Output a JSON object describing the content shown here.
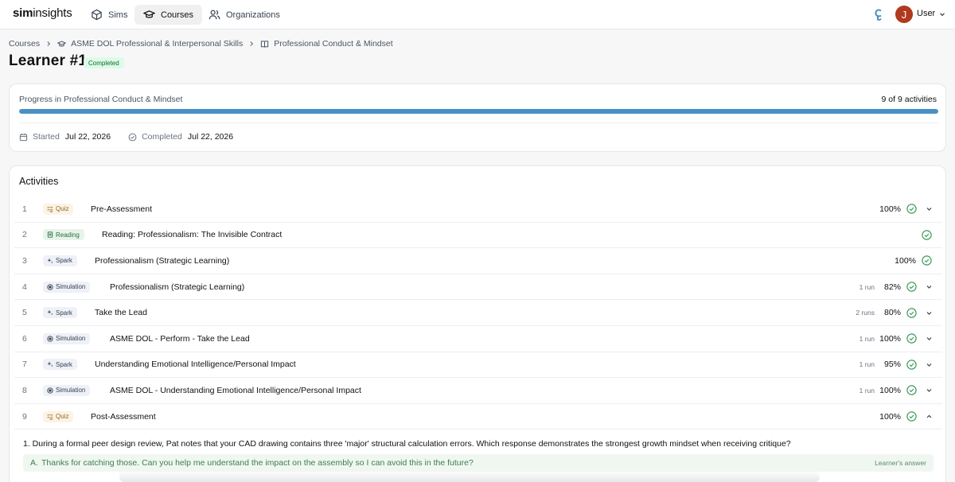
{
  "nav": {
    "logo_bold": "sim",
    "logo_light": "insights",
    "tabs": [
      {
        "label": "Sims",
        "icon": "cube-icon",
        "active": false
      },
      {
        "label": "Courses",
        "icon": "graduation-cap-icon",
        "active": true
      },
      {
        "label": "Organizations",
        "icon": "people-icon",
        "active": false
      }
    ],
    "user_initial": "J",
    "user_label": "User",
    "avatar_color": "#b0391e"
  },
  "breadcrumb": {
    "root": "Courses",
    "course": "ASME DOL Professional & Interpersonal Skills",
    "module": "Professional Conduct & Mindset"
  },
  "header": {
    "title": "Learner #1",
    "status_badge": "Completed"
  },
  "progress": {
    "label": "Progress in Professional Conduct & Mindset",
    "count_text": "9 of 9 activities",
    "fraction": 1.0,
    "started_label": "Started",
    "started_date": "Jul 22, 2026",
    "completed_label": "Completed",
    "completed_date": "Jul 22, 2026",
    "bar_color": "#4a90c4"
  },
  "activities": {
    "heading": "Activities",
    "rows": [
      {
        "num": "1",
        "type": "Quiz",
        "kind": "quiz",
        "title": "Pre-Assessment",
        "runs": "",
        "score": "100%",
        "expand": "down"
      },
      {
        "num": "2",
        "type": "Reading",
        "kind": "reading",
        "title": "Reading: Professionalism: The Invisible Contract",
        "runs": "",
        "score": "",
        "expand": "none"
      },
      {
        "num": "3",
        "type": "Spark",
        "kind": "spark",
        "title": "Professionalism (Strategic Learning)",
        "runs": "",
        "score": "100%",
        "expand": "none"
      },
      {
        "num": "4",
        "type": "Simulation",
        "kind": "sim",
        "title": "Professionalism (Strategic Learning)",
        "runs": "1 run",
        "score": "82%",
        "expand": "down"
      },
      {
        "num": "5",
        "type": "Spark",
        "kind": "spark",
        "title": "Take the Lead",
        "runs": "2 runs",
        "score": "80%",
        "expand": "down"
      },
      {
        "num": "6",
        "type": "Simulation",
        "kind": "sim",
        "title": "ASME DOL - Perform - Take the Lead",
        "runs": "1 run",
        "score": "100%",
        "expand": "down"
      },
      {
        "num": "7",
        "type": "Spark",
        "kind": "spark",
        "title": "Understanding Emotional Intelligence/Personal Impact",
        "runs": "1 run",
        "score": "95%",
        "expand": "down"
      },
      {
        "num": "8",
        "type": "Simulation",
        "kind": "sim",
        "title": "ASME DOL - Understanding Emotional Intelligence/Personal Impact",
        "runs": "1 run",
        "score": "100%",
        "expand": "down"
      },
      {
        "num": "9",
        "type": "Quiz",
        "kind": "quiz",
        "title": "Post-Assessment",
        "runs": "",
        "score": "100%",
        "expand": "up"
      }
    ],
    "expanded": {
      "question": "1. During a formal peer design review, Pat notes that your CAD drawing contains three 'major' structural calculation errors. Which response demonstrates the strongest growth mindset when receiving critique?",
      "answer_letter": "A.",
      "answer_text": "Thanks for catching those. Can you help me understand the impact on the assembly so I can avoid this in the future?",
      "answer_tag": "Learner's answer"
    }
  }
}
